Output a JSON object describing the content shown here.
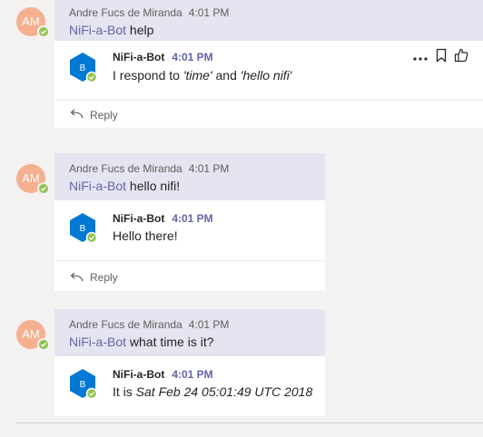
{
  "threads": [
    {
      "avatar_initials": "AM",
      "user_name": "Andre Fucs de Miranda",
      "user_time": "4:01 PM",
      "mention": "NiFi-a-Bot",
      "user_text": " help",
      "bot_name": "NiFi-a-Bot",
      "bot_time": "4:01 PM",
      "bot_text_prefix": "I respond to ",
      "bot_text_italic1": "'time'",
      "bot_text_mid": " and ",
      "bot_text_italic2": "'hello nifi'",
      "reply_label": "Reply",
      "more_icon": "more-icon",
      "bookmark_icon": "bookmark-icon",
      "like_icon": "like-icon"
    },
    {
      "avatar_initials": "AM",
      "user_name": "Andre Fucs de Miranda",
      "user_time": "4:01 PM",
      "mention": "NiFi-a-Bot",
      "user_text": " hello nifi!",
      "bot_name": "NiFi-a-Bot",
      "bot_time": "4:01 PM",
      "bot_text": "Hello there!",
      "reply_label": "Reply"
    },
    {
      "avatar_initials": "AM",
      "user_name": "Andre Fucs de Miranda",
      "user_time": "4:01 PM",
      "mention": "NiFi-a-Bot",
      "user_text": " what time is it?",
      "bot_name": "NiFi-a-Bot",
      "bot_time": "4:01 PM",
      "bot_text_prefix": "It is ",
      "bot_text_italic1": "Sat Feb 24 05:01:49 UTC 2018"
    }
  ],
  "bot_icon_letter": "B",
  "colors": {
    "accent": "#6264a7",
    "user_bubble": "#e5e5f1",
    "avatar": "#f4b08f",
    "presence": "#92c353",
    "bot_icon": "#0078d4"
  }
}
